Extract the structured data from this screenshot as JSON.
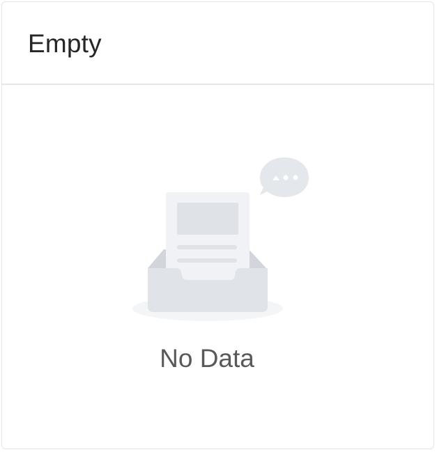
{
  "card": {
    "title": "Empty"
  },
  "empty": {
    "description": "No Data",
    "icon": "empty-inbox-icon"
  },
  "colors": {
    "border": "#e4e4e4",
    "title_text": "#262626",
    "description_text": "#595959",
    "illustration_light": "#eef0f3",
    "illustration_mid": "#e2e5ea",
    "illustration_dark": "#d6dae0"
  }
}
